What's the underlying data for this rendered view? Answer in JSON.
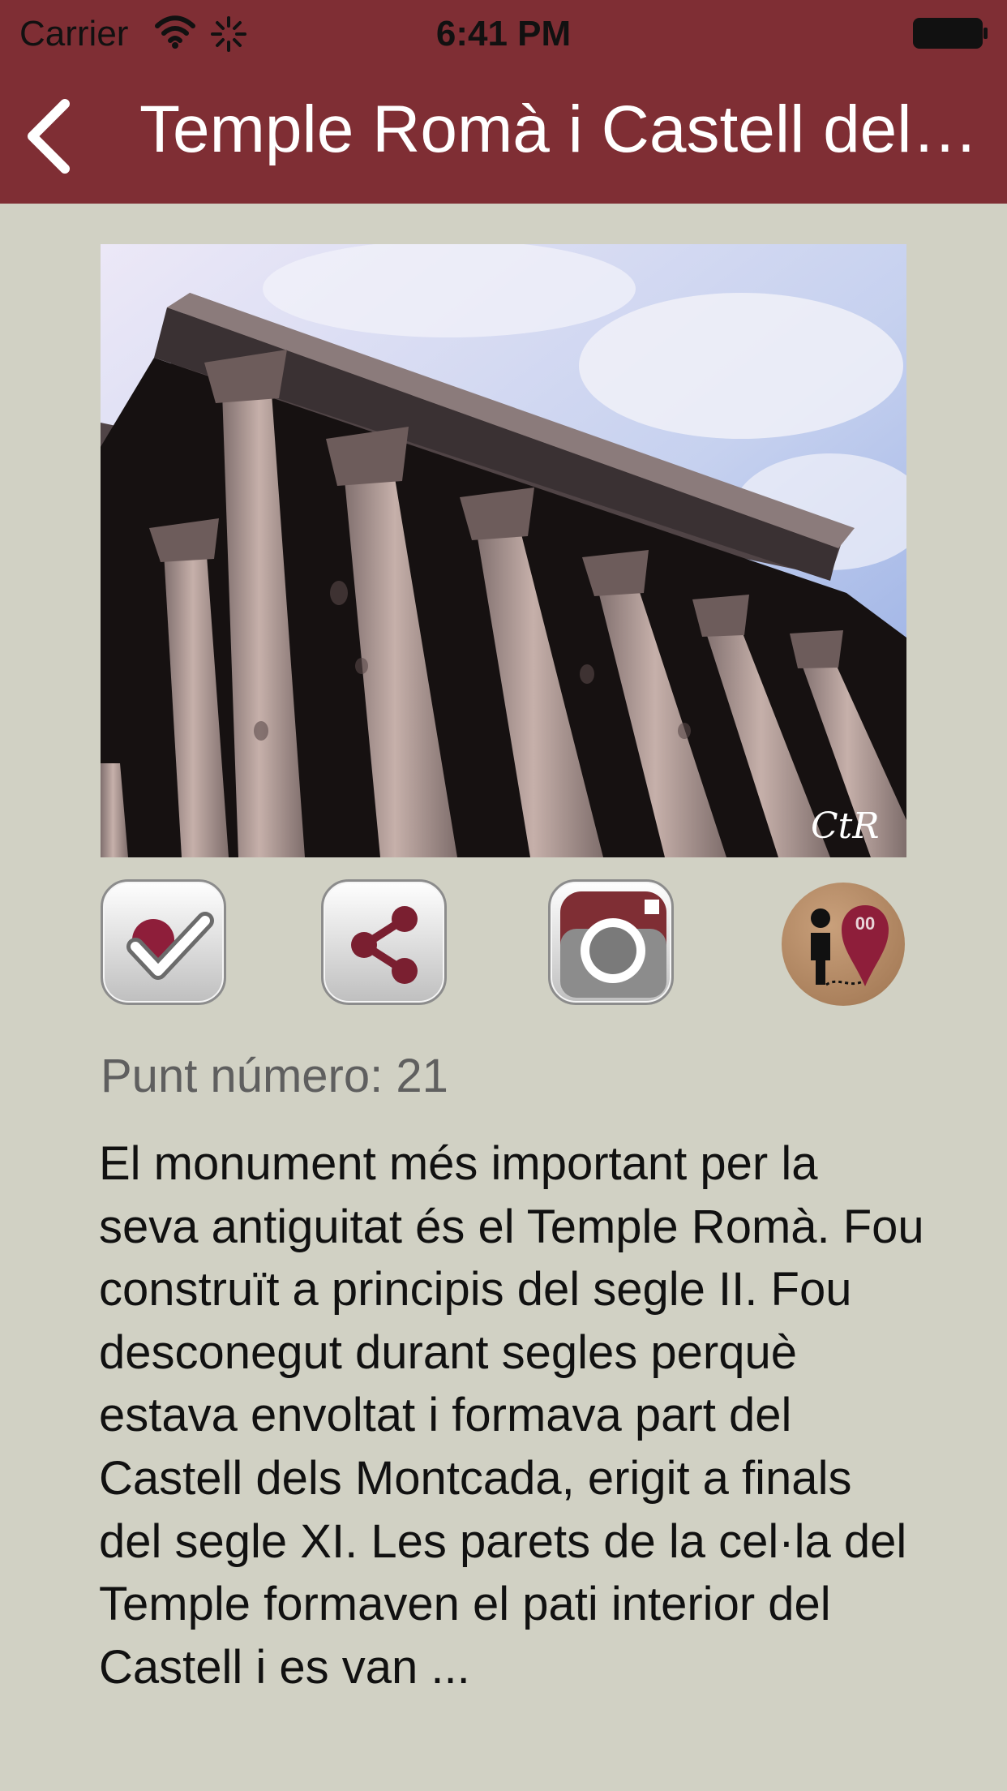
{
  "status_bar": {
    "carrier": "Carrier",
    "time": "6:41 PM",
    "wifi_icon": "wifi-icon",
    "activity_icon": "activity-spinner-icon",
    "battery_icon": "battery-icon"
  },
  "nav": {
    "back_icon": "chevron-left-icon",
    "title": "Temple Romà i Castell del Montcada"
  },
  "hero": {
    "image_description": "Low-angle view of a Roman temple's columns against a cloudy blue sky",
    "signature": "CtR"
  },
  "actions": [
    {
      "name": "visited-checkbox",
      "icon": "check-visited-icon",
      "accent": "#8e1e3a"
    },
    {
      "name": "share",
      "icon": "share-icon",
      "accent": "#7a1f30"
    },
    {
      "name": "camera",
      "icon": "camera-icon",
      "accent": "#7f2e34"
    },
    {
      "name": "route",
      "icon": "walking-route-icon",
      "badge": "00"
    }
  ],
  "point": {
    "label": "Punt número: 21"
  },
  "description": "El monument més important per la seva antiguitat és el Temple Romà. Fou construït a principis del segle II. Fou desconegut durant segles perquè estava envoltat i formava part del Castell dels Montcada, erigit a finals del segle XI. Les parets de la cel·la del Temple formaven el pati interior del Castell i es van ...",
  "colors": {
    "nav_bar": "#7f2e34",
    "background": "#d1d1c4",
    "text": "#111111",
    "muted_text": "#5f5f5f"
  }
}
